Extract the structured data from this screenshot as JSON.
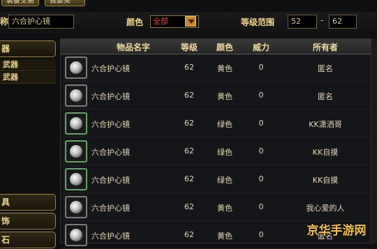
{
  "top_tabs": [
    "装备交易",
    "我要买"
  ],
  "filter": {
    "name_label": "称",
    "name_value": "六合护心镜",
    "color_label": "颜色",
    "color_value": "全部",
    "level_label": "等级范围",
    "level_min": "52",
    "level_sep": "-",
    "level_max": "62"
  },
  "sidebar": {
    "category": "器",
    "subitems": [
      "武器",
      "武器"
    ],
    "lower": [
      "具",
      "饰",
      "石"
    ]
  },
  "table": {
    "headers": [
      "物品名字",
      "等级",
      "颜色",
      "威力",
      "所有者"
    ],
    "rows": [
      {
        "name": "六合护心镜",
        "level": "62",
        "color": "黄色",
        "power": "0",
        "owner": "匿名",
        "rarity": "yellow"
      },
      {
        "name": "六合护心镜",
        "level": "62",
        "color": "黄色",
        "power": "0",
        "owner": "匿名",
        "rarity": "yellow"
      },
      {
        "name": "六合护心镜",
        "level": "62",
        "color": "绿色",
        "power": "0",
        "owner": "KK潇洒哥",
        "rarity": "green"
      },
      {
        "name": "六合护心镜",
        "level": "62",
        "color": "绿色",
        "power": "0",
        "owner": "KK自摸",
        "rarity": "green"
      },
      {
        "name": "六合护心镜",
        "level": "62",
        "color": "绿色",
        "power": "0",
        "owner": "KK自摸",
        "rarity": "green"
      },
      {
        "name": "六合护心镜",
        "level": "62",
        "color": "黄色",
        "power": "0",
        "owner": "我心爱的人",
        "rarity": "yellow"
      },
      {
        "name": "六合护心镜",
        "level": "62",
        "color": "黄色",
        "power": "0",
        "owner": "匿名",
        "rarity": "yellow"
      }
    ]
  },
  "watermark": "京华手游网",
  "colors": {
    "accent": "#f1d68a",
    "select_text": "#e05545",
    "arrow_bg": "#c58a2c"
  }
}
